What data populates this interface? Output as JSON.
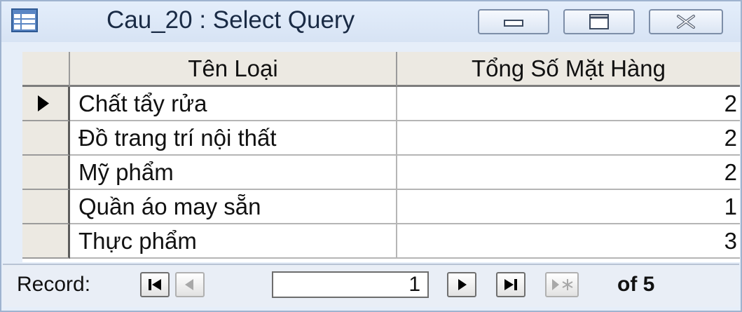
{
  "window": {
    "title": "Cau_20 : Select Query"
  },
  "icons": {
    "app": "query-datasheet-icon",
    "minimize": "minimize-icon",
    "maximize": "maximize-icon",
    "close": "close-icon",
    "current_record": "current-record-arrow-icon",
    "first": "first-record-icon",
    "prev": "previous-record-icon",
    "next": "next-record-icon",
    "last": "last-record-icon",
    "new": "new-record-icon"
  },
  "grid": {
    "columns": [
      "Tên Loại",
      "Tổng Số Mặt Hàng"
    ],
    "rows": [
      {
        "ten_loai": "Chất tẩy rửa",
        "tong_so": "2"
      },
      {
        "ten_loai": "Đồ trang trí nội thất",
        "tong_so": "2"
      },
      {
        "ten_loai": "Mỹ phẩm",
        "tong_so": "2"
      },
      {
        "ten_loai": "Quần áo may sẵn",
        "tong_so": "1"
      },
      {
        "ten_loai": "Thực phẩm",
        "tong_so": "3"
      }
    ],
    "current_row": 1
  },
  "navigation": {
    "label": "Record:",
    "current": "1",
    "total_text": "of 5"
  },
  "colors": {
    "window_bg": "#e6eef9",
    "header_bg": "#ece9e2",
    "border": "#9fb3cf"
  }
}
